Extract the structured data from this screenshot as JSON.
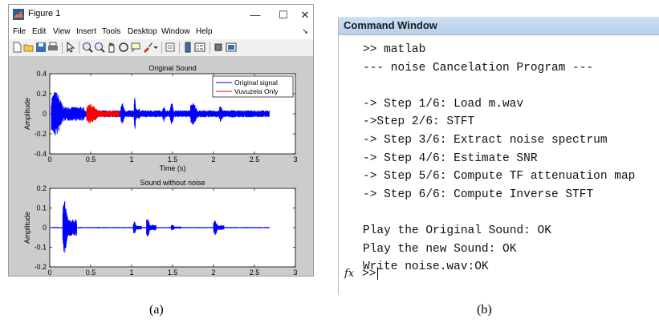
{
  "figure_window": {
    "title": "Figure 1",
    "controls": {
      "minimize": "—",
      "maximize": "☐",
      "close": "✕"
    },
    "menu": [
      "File",
      "Edit",
      "View",
      "Insert",
      "Tools",
      "Desktop",
      "Window",
      "Help"
    ],
    "menu_overflow": "➘",
    "toolbar_icons": [
      "new-figure-icon",
      "open-file-icon",
      "save-icon",
      "print-icon",
      "pointer-icon",
      "zoom-in-icon",
      "zoom-out-icon",
      "pan-icon",
      "rotate-icon",
      "data-cursor-icon",
      "brush-icon",
      "link-plot-icon",
      "colorbar-icon",
      "legend-icon",
      "hide-plot-tools-icon",
      "show-plot-tools-icon"
    ]
  },
  "chart_data": [
    {
      "type": "line",
      "title": "Original Sound",
      "xlabel": "Time (s)",
      "ylabel": "Amplitude",
      "xlim": [
        0,
        3
      ],
      "ylim": [
        -0.4,
        0.4
      ],
      "xticks": [
        "0",
        "0.5",
        "1",
        "1.5",
        "2",
        "2.5",
        "3"
      ],
      "yticks": [
        "0.4",
        "0.2",
        "0",
        "-0.2",
        "-0.4"
      ],
      "legend": {
        "position": "top-right"
      },
      "series": [
        {
          "name": "Original signal",
          "color": "#0000ff",
          "bursts": [
            {
              "start": 0.02,
              "end": 0.42,
              "amp": 0.28
            },
            {
              "start": 0.87,
              "end": 1.0,
              "amp": 0.14
            },
            {
              "start": 1.03,
              "end": 1.1,
              "amp": 0.2
            },
            {
              "start": 1.38,
              "end": 1.48,
              "amp": 0.1
            },
            {
              "start": 1.47,
              "end": 1.6,
              "amp": 0.14
            },
            {
              "start": 1.72,
              "end": 1.95,
              "amp": 0.14
            },
            {
              "start": 2.07,
              "end": 2.2,
              "amp": 0.1
            },
            {
              "start": 2.2,
              "end": 2.45,
              "amp": 0.05
            }
          ],
          "noise_amp": 0.035,
          "x_end": 2.68
        },
        {
          "name": "Vuvuzela Only",
          "color": "#ff0000",
          "bursts": [
            {
              "start": 0.45,
              "end": 0.85,
              "amp": 0.12
            }
          ]
        }
      ]
    },
    {
      "type": "line",
      "title": "Sound without noise",
      "xlabel": "Time (s)",
      "ylabel": "Amplitude",
      "xlim": [
        0,
        3
      ],
      "ylim": [
        -0.2,
        0.2
      ],
      "xticks": [
        "0",
        "0.5",
        "1",
        "1.5",
        "2",
        "2.5",
        "3"
      ],
      "yticks": [
        "0.2",
        "0.1",
        "0",
        "-0.1",
        "-0.2"
      ],
      "series": [
        {
          "color": "#0000ff",
          "bursts": [
            {
              "start": 0.16,
              "end": 0.33,
              "amp": 0.17
            },
            {
              "start": 1.02,
              "end": 1.12,
              "amp": 0.04
            },
            {
              "start": 1.18,
              "end": 1.3,
              "amp": 0.06
            },
            {
              "start": 1.48,
              "end": 1.6,
              "amp": 0.02
            },
            {
              "start": 2.0,
              "end": 2.13,
              "amp": 0.05
            }
          ],
          "noise_amp": 0.003,
          "x_end": 2.68
        }
      ]
    }
  ],
  "command_window": {
    "title": "Command Window",
    "lines": [
      ">> matlab",
      "--- noise Cancelation Program ---",
      "",
      "-> Step 1/6: Load m.wav",
      "->Step 2/6: STFT",
      "-> Step 3/6: Extract noise spectrum",
      "-> Step 4/6: Estimate SNR",
      "-> Step 5/6: Compute TF attenuation map",
      "-> Step 6/6: Compute Inverse STFT",
      "",
      "Play the Original Sound: OK",
      "Play the new Sound: OK",
      "Write noise.wav:OK"
    ],
    "fx_label": "fx",
    "prompt": ">>"
  },
  "captions": {
    "a": "(a)",
    "b": "(b)"
  }
}
